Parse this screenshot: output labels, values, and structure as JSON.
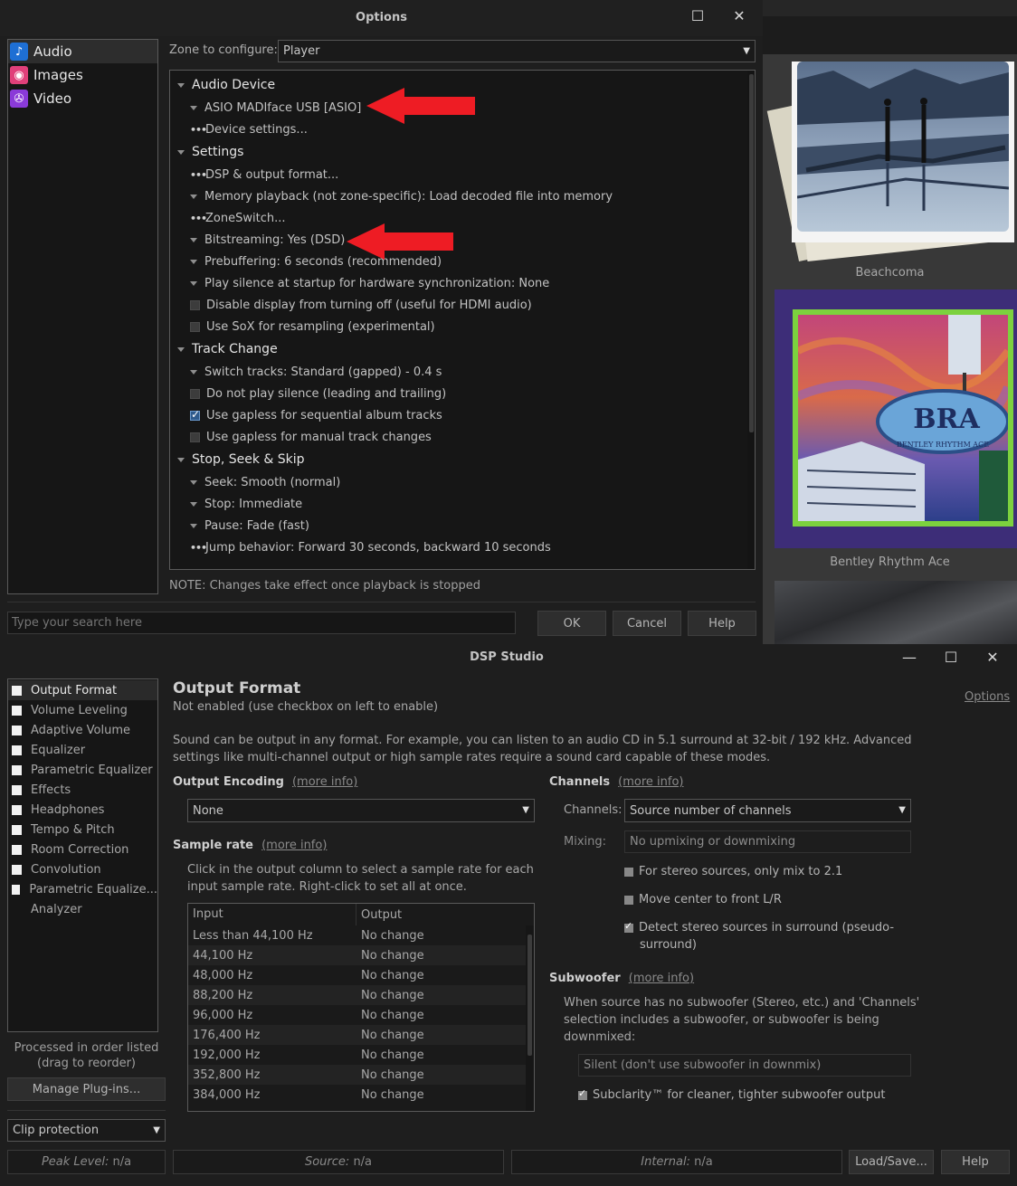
{
  "options": {
    "title": "Options",
    "window_controls": {
      "maximize": "☐",
      "close": "✕"
    },
    "sidebar": [
      {
        "label": "Audio",
        "icon": "music-note-icon",
        "color": "#1e6fd4",
        "selected": true
      },
      {
        "label": "Images",
        "icon": "camera-icon",
        "color": "#e0407a",
        "selected": false
      },
      {
        "label": "Video",
        "icon": "projector-icon",
        "color": "#8a3ad8",
        "selected": false
      }
    ],
    "zone_label": "Zone to configure:",
    "zone_value": "Player",
    "tree": [
      {
        "kind": "head",
        "label": "Audio Device"
      },
      {
        "kind": "tri",
        "label": "ASIO MADIface USB [ASIO]"
      },
      {
        "kind": "dots",
        "label": "Device settings..."
      },
      {
        "kind": "head",
        "label": "Settings"
      },
      {
        "kind": "dots",
        "label": "DSP & output format..."
      },
      {
        "kind": "tri",
        "label": "Memory playback (not zone-specific): Load decoded file into memory"
      },
      {
        "kind": "dots",
        "label": "ZoneSwitch..."
      },
      {
        "kind": "tri",
        "label": "Bitstreaming: Yes (DSD)"
      },
      {
        "kind": "tri",
        "label": "Prebuffering: 6 seconds (recommended)"
      },
      {
        "kind": "tri",
        "label": "Play silence at startup for hardware synchronization: None"
      },
      {
        "kind": "cb",
        "checked": false,
        "label": "Disable display from turning off (useful for HDMI audio)"
      },
      {
        "kind": "cb",
        "checked": false,
        "label": "Use SoX for resampling (experimental)"
      },
      {
        "kind": "head",
        "label": "Track Change"
      },
      {
        "kind": "tri",
        "label": "Switch tracks: Standard (gapped) - 0.4 s"
      },
      {
        "kind": "cb",
        "checked": false,
        "label": "Do not play silence (leading and trailing)"
      },
      {
        "kind": "cb",
        "checked": true,
        "label": "Use gapless for sequential album tracks"
      },
      {
        "kind": "cb",
        "checked": false,
        "label": "Use gapless for manual track changes"
      },
      {
        "kind": "head",
        "label": "Stop, Seek & Skip"
      },
      {
        "kind": "tri",
        "label": "Seek: Smooth (normal)"
      },
      {
        "kind": "tri",
        "label": "Stop: Immediate"
      },
      {
        "kind": "tri",
        "label": "Pause: Fade (fast)"
      },
      {
        "kind": "dots",
        "label": "Jump behavior: Forward 30 seconds, backward 10 seconds"
      }
    ],
    "note": "NOTE: Changes take effect once playback is stopped",
    "search_placeholder": "Type your search here",
    "buttons": {
      "ok": "OK",
      "cancel": "Cancel",
      "help": "Help"
    },
    "annotation_arrow_color": "#ee1c24"
  },
  "albums": [
    {
      "caption": "Beachcoma"
    },
    {
      "caption": "Bentley Rhythm Ace",
      "sign_text": "BRA",
      "sign_subtext": "BENTLEY RHYTHM ACE"
    }
  ],
  "dsp": {
    "title": "DSP Studio",
    "window_controls": {
      "minimize": "—",
      "maximize": "☐",
      "close": "✕"
    },
    "plugins": [
      {
        "label": "Output Format",
        "checkbox": true,
        "selected": true
      },
      {
        "label": "Volume Leveling",
        "checkbox": true
      },
      {
        "label": "Adaptive Volume",
        "checkbox": true
      },
      {
        "label": "Equalizer",
        "checkbox": true
      },
      {
        "label": "Parametric Equalizer",
        "checkbox": true
      },
      {
        "label": "Effects",
        "checkbox": true
      },
      {
        "label": "Headphones",
        "checkbox": true
      },
      {
        "label": "Tempo & Pitch",
        "checkbox": true
      },
      {
        "label": "Room Correction",
        "checkbox": true
      },
      {
        "label": "Convolution",
        "checkbox": true
      },
      {
        "label": "Parametric Equalize...",
        "checkbox": true
      },
      {
        "label": "Analyzer",
        "checkbox": false
      }
    ],
    "order_note_1": "Processed in order listed",
    "order_note_2": "(drag to reorder)",
    "manage_plugins": "Manage Plug-ins...",
    "clip_protection": "Clip protection",
    "heading": "Output Format",
    "subheading": "Not enabled (use checkbox on left to enable)",
    "options_link": "Options",
    "description_1": "Sound can be output in any format.  For example, you can listen to an audio CD in 5.1 surround at 32-bit / 192 kHz.  Advanced",
    "description_2": "settings like multi-channel output or high sample rates require a sound card capable of these modes.",
    "more_info": "(more info)",
    "output_encoding": {
      "label": "Output Encoding",
      "value": "None"
    },
    "sample_rate": {
      "label": "Sample rate",
      "help_1": "Click in the output column to select a sample rate for each",
      "help_2": "input sample rate.  Right-click to set all at once.",
      "columns": [
        "Input",
        "Output"
      ],
      "rows": [
        [
          "Less than 44,100 Hz",
          "No change"
        ],
        [
          "44,100 Hz",
          "No change"
        ],
        [
          "48,000 Hz",
          "No change"
        ],
        [
          "88,200 Hz",
          "No change"
        ],
        [
          "96,000 Hz",
          "No change"
        ],
        [
          "176,400 Hz",
          "No change"
        ],
        [
          "192,000 Hz",
          "No change"
        ],
        [
          "352,800 Hz",
          "No change"
        ],
        [
          "384,000 Hz",
          "No change"
        ]
      ]
    },
    "channels": {
      "label": "Channels",
      "channels_label": "Channels:",
      "channels_value": "Source number of channels",
      "mixing_label": "Mixing:",
      "mixing_value": "No upmixing or downmixing",
      "opt1": "For stereo sources, only mix to 2.1",
      "opt2": "Move center to front L/R",
      "opt3a": "Detect stereo sources in surround (pseudo-",
      "opt3b": "surround)"
    },
    "subwoofer": {
      "label": "Subwoofer",
      "help_1": "When source has no subwoofer (Stereo, etc.) and 'Channels'",
      "help_2": "selection includes a subwoofer, or subwoofer is being",
      "help_3": "downmixed:",
      "value": "Silent (don't use subwoofer in downmix)",
      "subclarity": "Subclarity™ for cleaner, tighter subwoofer output"
    },
    "status": {
      "peak_label": "Peak Level:",
      "peak_value": "n/a",
      "source_label": "Source:",
      "source_value": "n/a",
      "internal_label": "Internal:",
      "internal_value": "n/a"
    },
    "load_save": "Load/Save...",
    "help": "Help"
  }
}
